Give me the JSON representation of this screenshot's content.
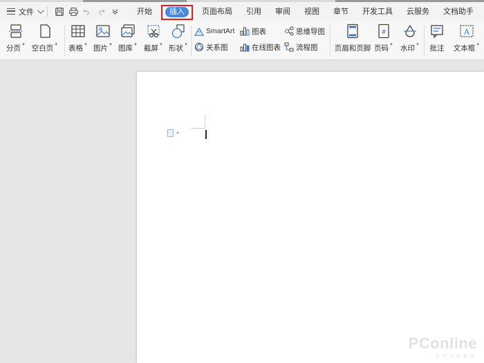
{
  "menubar": {
    "file_label": "文件",
    "tabs": [
      {
        "label": "开始"
      },
      {
        "label": "插入",
        "active": true
      },
      {
        "label": "页面布局"
      },
      {
        "label": "引用"
      },
      {
        "label": "审阅"
      },
      {
        "label": "视图"
      },
      {
        "label": "章节"
      },
      {
        "label": "开发工具"
      },
      {
        "label": "云服务"
      },
      {
        "label": "文档助手"
      }
    ],
    "quick_access": [
      "save-icon",
      "print-icon",
      "undo-icon",
      "redo-icon",
      "customize-dropdown-icon"
    ]
  },
  "ribbon": {
    "page_break": "分页",
    "blank_page": "空白页",
    "table": "表格",
    "picture": "图片",
    "gallery": "图库",
    "screenshot": "截屏",
    "shapes": "形状",
    "smartart": "SmartArt",
    "chart": "图表",
    "mind_map": "思维导图",
    "relation_chart": "关系图",
    "online_chart": "在线图表",
    "flowchart": "流程图",
    "header_footer": "页眉和页脚",
    "page_number": "页码",
    "watermark": "水印",
    "comment": "批注",
    "text_box": "文本框"
  },
  "colors": {
    "active_tab_pill": "#4a86d9",
    "highlight_box": "#e21c1c",
    "icon_blue": "#3f79c6"
  },
  "watermark": {
    "brand": "PConline",
    "subtitle": "太平洋电脑网"
  }
}
